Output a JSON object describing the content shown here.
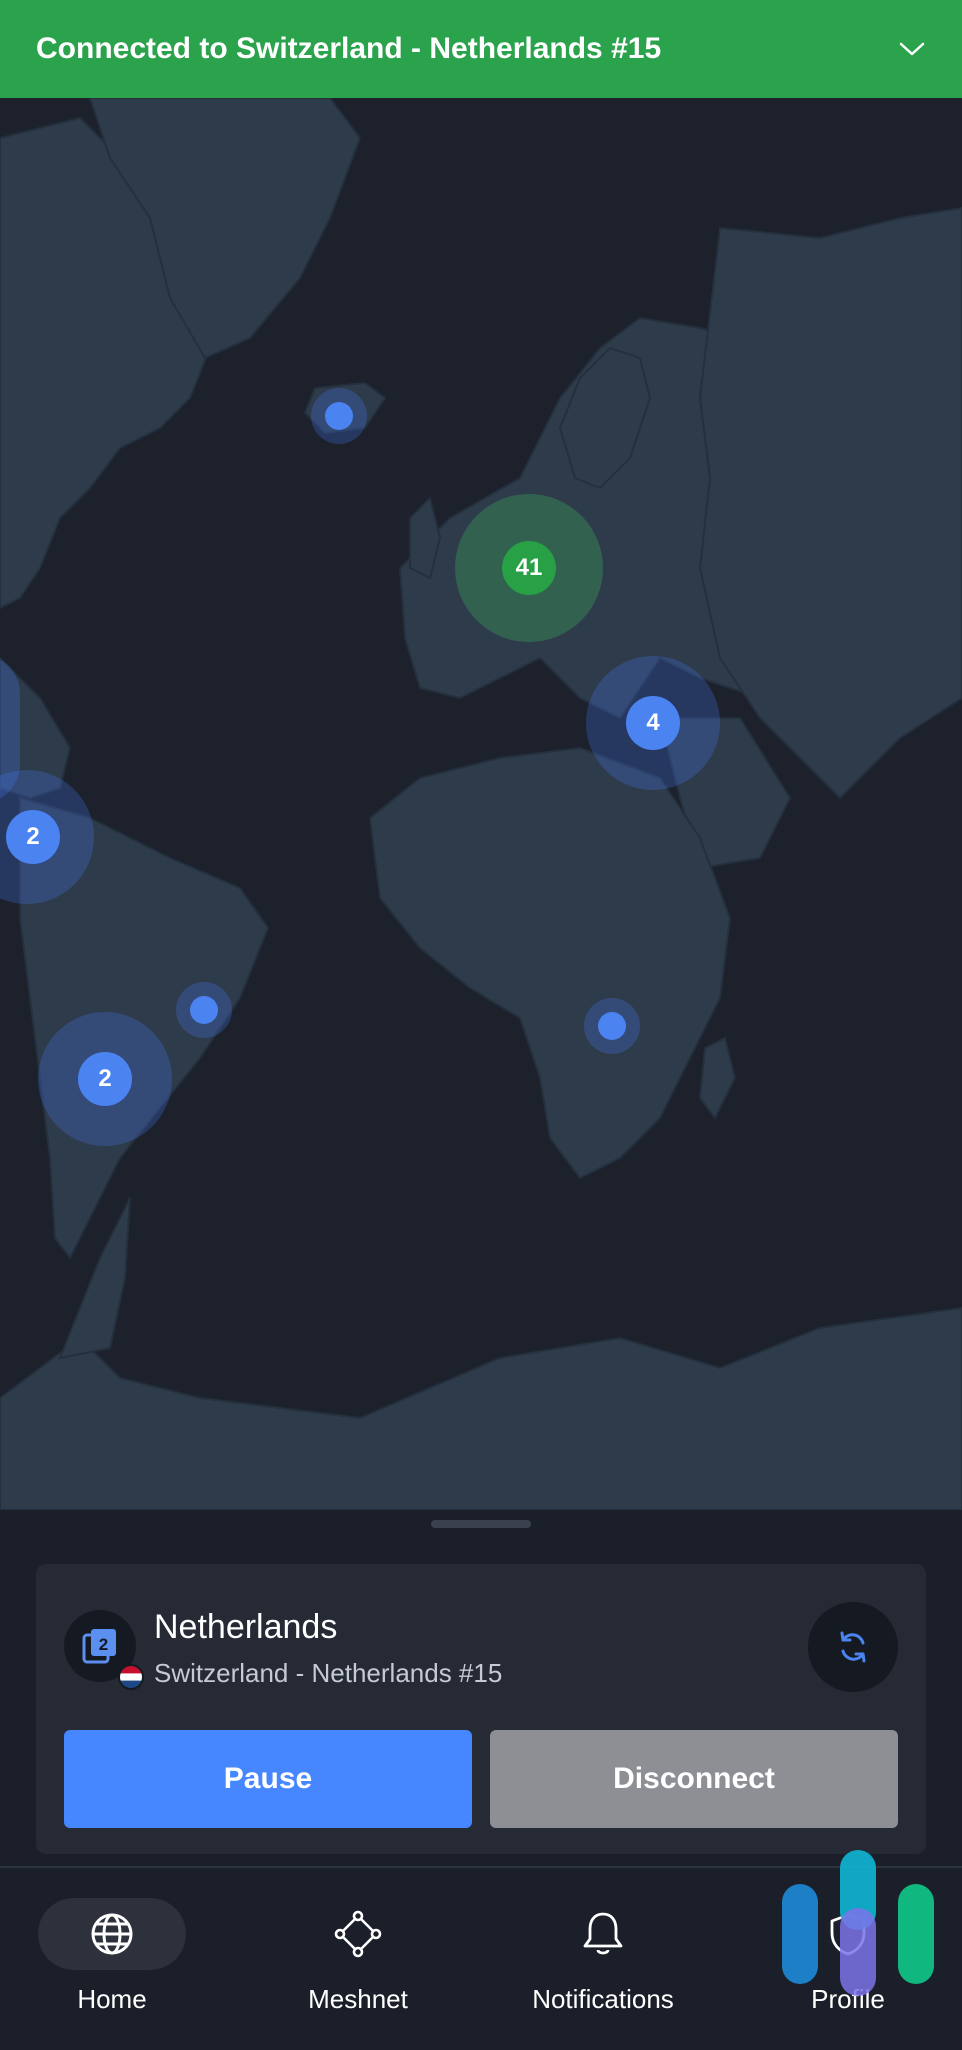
{
  "connection_banner": {
    "title": "Connected to Switzerland - Netherlands #15",
    "icon": "chevron-down-icon",
    "color": "#2aa34c"
  },
  "map": {
    "clusters": [
      {
        "label": "41",
        "status": "connected",
        "color": "#27a046"
      },
      {
        "label": "4",
        "color": "#4b83f0"
      },
      {
        "label": "2",
        "color": "#4b83f0"
      },
      {
        "label": "2",
        "color": "#4b83f0"
      }
    ]
  },
  "connection_card": {
    "country": "Netherlands",
    "server": "Switzerland - Netherlands #15",
    "server_icon": "double-vpn-icon",
    "flag": "netherlands-flag",
    "refresh_icon": "refresh-icon"
  },
  "actions": {
    "pause_label": "Pause",
    "disconnect_label": "Disconnect",
    "pause_color": "#4687ff",
    "disconnect_color": "#8d8f95"
  },
  "nav": {
    "items": [
      {
        "label": "Home",
        "icon": "globe-icon",
        "active": true
      },
      {
        "label": "Meshnet",
        "icon": "meshnet-icon",
        "active": false
      },
      {
        "label": "Notifications",
        "icon": "bell-icon",
        "active": false
      },
      {
        "label": "Profile",
        "icon": "shield-icon",
        "active": false
      }
    ]
  }
}
